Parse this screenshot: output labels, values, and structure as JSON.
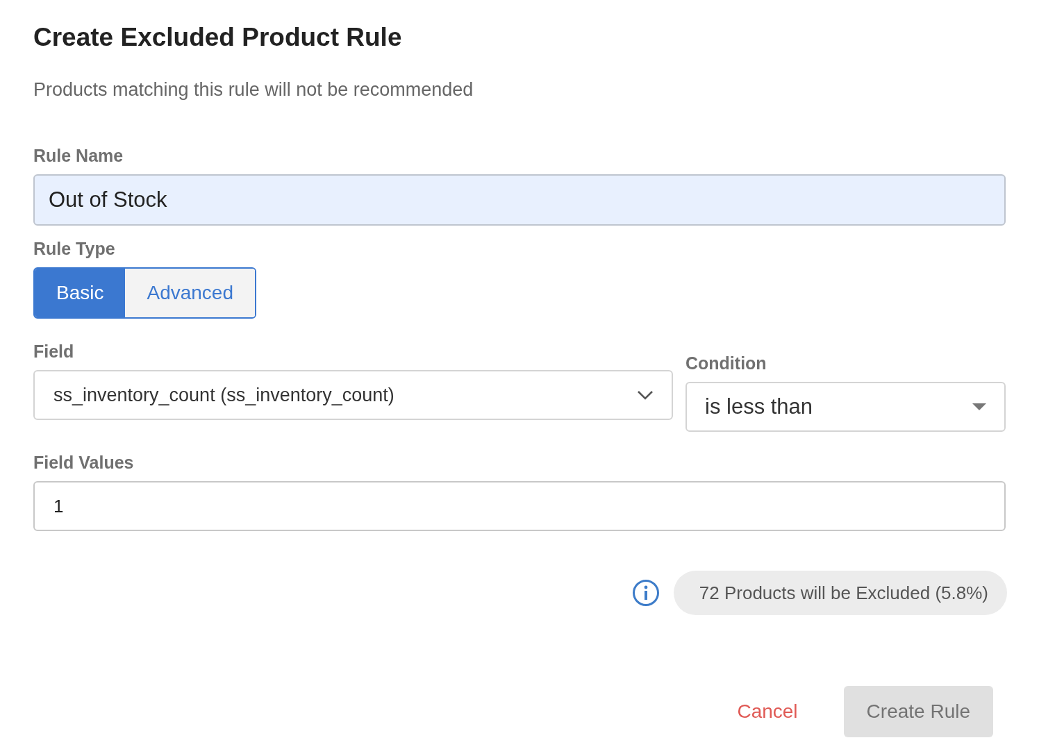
{
  "dialog": {
    "title": "Create Excluded Product Rule",
    "subtitle": "Products matching this rule will not be recommended"
  },
  "rule_name": {
    "label": "Rule Name",
    "value": "Out of Stock"
  },
  "rule_type": {
    "label": "Rule Type",
    "options": [
      {
        "label": "Basic",
        "selected": true
      },
      {
        "label": "Advanced",
        "selected": false
      }
    ]
  },
  "selects": [
    {
      "label": "Field",
      "value": "ss_inventory_count (ss_inventory_count)",
      "kind": "chevron"
    },
    {
      "label": "Condition",
      "value": "is less than",
      "kind": "caret"
    }
  ],
  "field_values": {
    "label": "Field Values",
    "value": "1"
  },
  "summary": {
    "text": "72 Products will be Excluded (5.8%)"
  },
  "buttons": [
    {
      "label": "Cancel",
      "kind": "text",
      "disabled": false
    },
    {
      "label": "Create Rule",
      "kind": "primary",
      "disabled": true
    }
  ]
}
